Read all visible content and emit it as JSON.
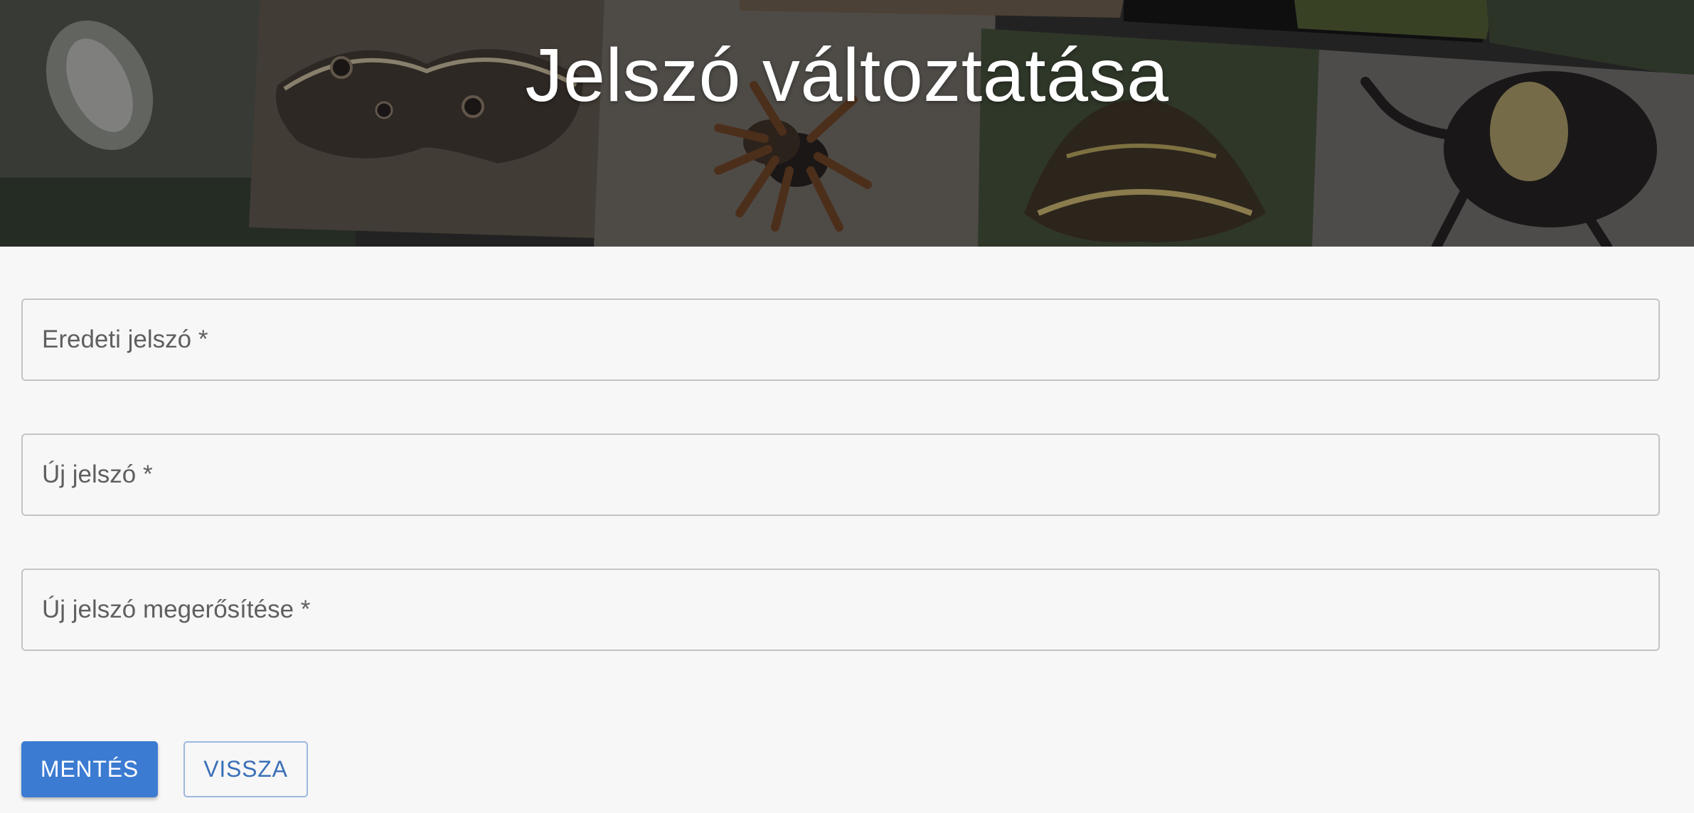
{
  "header": {
    "title": "Jelszó változtatása",
    "background": "insect-photo-collage"
  },
  "form": {
    "fields": [
      {
        "name": "original-password",
        "label": "Eredeti jelszó *",
        "value": "",
        "type": "password"
      },
      {
        "name": "new-password",
        "label": "Új jelszó *",
        "value": "",
        "type": "password"
      },
      {
        "name": "confirm-new-password",
        "label": "Új jelszó megerősítése *",
        "value": "",
        "type": "password"
      }
    ]
  },
  "actions": {
    "save_label": "MENTÉS",
    "back_label": "VISSZA"
  },
  "colors": {
    "primary": "#3b7bd2",
    "outline_text": "#3b6fb8",
    "page_background": "#f7f7f7"
  }
}
